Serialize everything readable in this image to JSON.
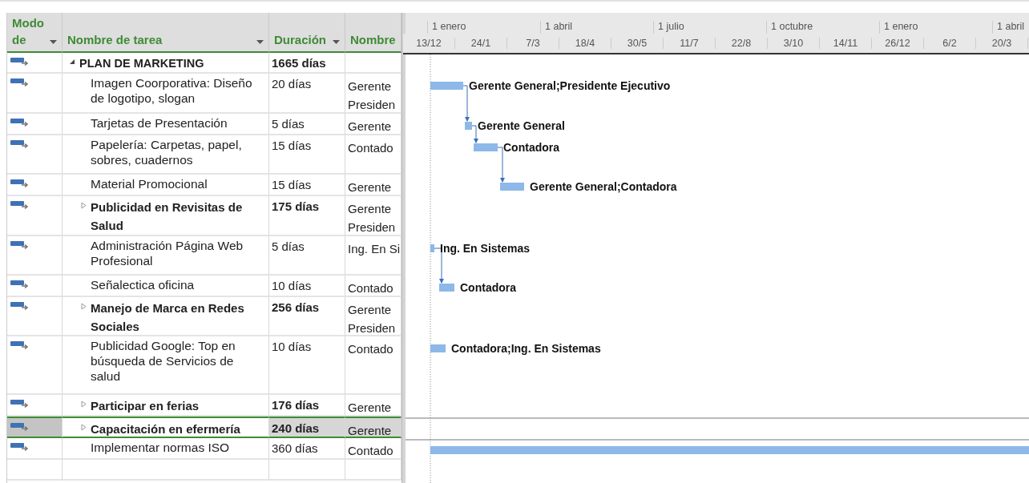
{
  "columns": [
    {
      "label_lines": [
        "Modo",
        "de"
      ],
      "dropdown": true
    },
    {
      "label_lines": [
        "Nombre de tarea"
      ],
      "dropdown": true
    },
    {
      "label_lines": [
        "Duración"
      ],
      "dropdown": true
    },
    {
      "label_lines": [
        "Nombre"
      ],
      "dropdown": false
    }
  ],
  "timescale": {
    "top": [
      "1 enero",
      "1 abril",
      "1 julio",
      "1 octubre",
      "1 enero",
      "1 abril"
    ],
    "bottom": [
      "13/12",
      "24/1",
      "7/3",
      "18/4",
      "30/5",
      "11/7",
      "22/8",
      "3/10",
      "14/11",
      "26/12",
      "6/2",
      "20/3"
    ]
  },
  "tasks": [
    {
      "name": "PLAN DE MARKETING",
      "duration": "1665 días",
      "kind": "summary",
      "expanded": true,
      "selected": false,
      "children": [
        {
          "name": "Imagen Coorporativa: Diseño de logotipo, slogan",
          "duration": "20 días",
          "resource_lines": [
            "Gerente",
            "Presiden"
          ],
          "kind": "task",
          "selected": false,
          "gantt_label": "Gerente General;Presidente Ejecutivo"
        },
        {
          "name": "Tarjetas de Presentación",
          "duration": "5 días",
          "resource_lines": [
            "Gerente"
          ],
          "kind": "task",
          "selected": false,
          "gantt_label": "Gerente General"
        },
        {
          "name": "Papelería: Carpetas, papel, sobres, cuadernos",
          "duration": "15 días",
          "resource_lines": [
            "Contado"
          ],
          "kind": "task",
          "selected": false,
          "gantt_label": "Contadora"
        },
        {
          "name": "Material Promocional",
          "duration": "15 días",
          "resource_lines": [
            "Gerente"
          ],
          "kind": "task",
          "selected": false,
          "gantt_label": "Gerente General;Contadora"
        },
        {
          "name": "Publicidad en Revisitas de Salud",
          "duration": "175 días",
          "resource_lines": [
            "Gerente",
            "Presiden"
          ],
          "kind": "summary",
          "expanded": false,
          "selected": false
        },
        {
          "name": "Administración Página Web Profesional",
          "duration": "5 días",
          "resource_lines": [
            "Ing. En Si"
          ],
          "kind": "task",
          "selected": false,
          "gantt_label": "Ing. En Sistemas"
        },
        {
          "name": "Señalectica oficina",
          "duration": "10 días",
          "resource_lines": [
            "Contado"
          ],
          "kind": "task",
          "selected": false,
          "gantt_label": "Contadora"
        },
        {
          "name": "Manejo de Marca en Redes Sociales",
          "duration": "256 días",
          "resource_lines": [
            "Gerente",
            "Presiden"
          ],
          "kind": "summary",
          "expanded": false,
          "selected": false
        },
        {
          "name": "Publicidad Google: Top en búsqueda de Servicios de salud",
          "duration": "10 días",
          "resource_lines": [
            "Contado"
          ],
          "kind": "task",
          "selected": false,
          "gantt_label": "Contadora;Ing. En Sistemas"
        },
        {
          "name": "Participar en ferias",
          "duration": "176 días",
          "resource_lines": [
            "Gerente"
          ],
          "kind": "summary",
          "expanded": false,
          "selected": false
        },
        {
          "name": "Capacitación en efermería",
          "duration": "240 días",
          "resource_lines": [
            "Gerente"
          ],
          "kind": "summary",
          "expanded": false,
          "selected": true
        },
        {
          "name": "Implementar normas ISO",
          "duration": "360 días",
          "resource_lines": [
            "Contado"
          ],
          "kind": "task",
          "selected": false
        }
      ]
    }
  ]
}
